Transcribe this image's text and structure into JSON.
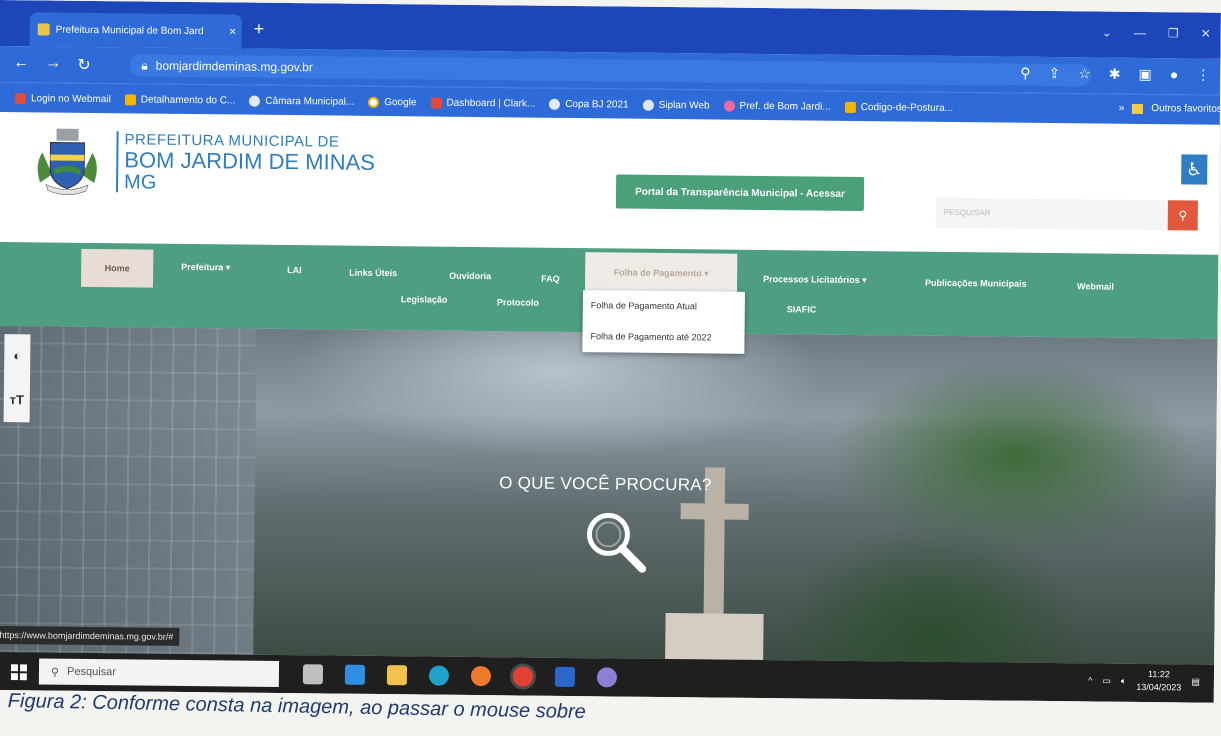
{
  "browser": {
    "tab_title": "Prefeitura Municipal de Bom Jard",
    "tab_close": "×",
    "new_tab": "+",
    "url": "bomjardimdeminas.mg.gov.br",
    "bookmarks": [
      {
        "label": "Login no Webmail",
        "icon": "webmail-icon"
      },
      {
        "label": "Detalhamento do C...",
        "icon": "site-icon"
      },
      {
        "label": "Câmara Municipal...",
        "icon": "globe-icon"
      },
      {
        "label": "Google",
        "icon": "google-icon"
      },
      {
        "label": "Dashboard | Clark...",
        "icon": "dashboard-icon"
      },
      {
        "label": "Copa BJ 2021",
        "icon": "globe-icon"
      },
      {
        "label": "Siplan Web",
        "icon": "globe-icon"
      },
      {
        "label": "Pref. de Bom Jardi...",
        "icon": "site-icon"
      },
      {
        "label": "Codigo-de-Postura...",
        "icon": "crest-icon"
      }
    ],
    "bookmarks_overflow": "»",
    "other_bookmarks": "Outros favoritos"
  },
  "site": {
    "brand_line1": "PREFEITURA MUNICIPAL DE",
    "brand_line2": "BOM JARDIM DE MINAS",
    "brand_line3": "MG",
    "portal_button": "Portal da Transparência Municipal - Acessar",
    "search_placeholder": "PESQUISAR",
    "menu_row1": [
      "Home",
      "Prefeitura ▾",
      "LAI",
      "Links Úteis",
      "Ouvidoria",
      "FAQ",
      "Folha de Pagamento ▾",
      "Processos Licitatórios ▾",
      "Publicações Municipais",
      "Webmail"
    ],
    "menu_row2": [
      "Legislação",
      "Protocolo",
      "SIAFIC"
    ],
    "dropdown": [
      "Folha de Pagamento Atual",
      "Folha de Pagamento até 2022"
    ],
    "hero_title": "O QUE VOCÊ PROCURA?",
    "status_url": "https://www.bomjardimdeminas.mg.gov.br/#",
    "contrast_tool": "◐",
    "font_tool": "тT"
  },
  "taskbar": {
    "search_placeholder": "Pesquisar",
    "time": "11:22",
    "date": "13/04/2023"
  },
  "caption": "Figura 2: Conforme consta na imagem, ao passar o mouse sobre"
}
